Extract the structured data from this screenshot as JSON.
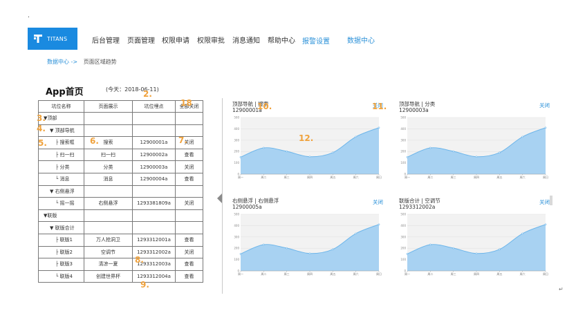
{
  "header": {
    "logo_text": "TITANS",
    "nav": [
      "后台管理",
      "页面管理",
      "权限申请",
      "权限审批",
      "消息通知",
      "帮助中心",
      "报警设置",
      "数据中心"
    ]
  },
  "breadcrumb": {
    "link": "数据中心 ->",
    "current": "页面区域趋势"
  },
  "page": {
    "title": "App首页",
    "date": "(今天：2018-06-11)"
  },
  "table": {
    "headers": [
      "坑位名称",
      "页面展示",
      "坑位埋点",
      "全部关闭"
    ],
    "rows": [
      {
        "name": "▼顶部",
        "display": "",
        "code": "",
        "action": ""
      },
      {
        "name": "▼ 顶部导航",
        "display": "",
        "code": "",
        "action": ""
      },
      {
        "name": "├ 搜索框",
        "display": "搜索",
        "code": "12900001a",
        "action": "关闭"
      },
      {
        "name": "├ 扫一扫",
        "display": "扫一扫",
        "code": "12900002a",
        "action": "查看"
      },
      {
        "name": "├ 分类",
        "display": "分类",
        "code": "12900003a",
        "action": "关闭"
      },
      {
        "name": "└ 消息",
        "display": "消息",
        "code": "12900004a",
        "action": "查看"
      },
      {
        "name": "▼ 右侧悬浮",
        "display": "",
        "code": "",
        "action": ""
      },
      {
        "name": "└ 摇一摇",
        "display": "右侧悬浮",
        "code": "1293381809a",
        "action": "关闭"
      },
      {
        "name": "▼联版",
        "display": "",
        "code": "",
        "action": ""
      },
      {
        "name": "▼ 联版合计",
        "display": "",
        "code": "",
        "action": ""
      },
      {
        "name": "├ 联版1",
        "display": "万人抢洞卫",
        "code": "1293312001a",
        "action": "查看"
      },
      {
        "name": "├ 联版2",
        "display": "空调节",
        "code": "1293312002a",
        "action": "关闭"
      },
      {
        "name": "├ 联版3",
        "display": "清凉一夏",
        "code": "1293312003a",
        "action": "查看"
      },
      {
        "name": "└ 联版4",
        "display": "创建世界杯",
        "code": "1293312004a",
        "action": "查看"
      }
    ]
  },
  "annotations": [
    "2.",
    "3.",
    "4.",
    "5.",
    "6.",
    "7.",
    "8.",
    "9.",
    "10.",
    "11.",
    "12.",
    "18"
  ],
  "panels": [
    {
      "title": "顶部导航 | 搜索",
      "code": "12900001a",
      "close": "关闭"
    },
    {
      "title": "顶部导航 | 分类",
      "code": "12900003a",
      "close": "关闭"
    },
    {
      "title": "右侧悬浮 | 右侧悬浮",
      "code": "12900005a",
      "close": "关闭"
    },
    {
      "title": "联版合计 | 空调节",
      "code": "1293312002a",
      "close": "关闭"
    }
  ],
  "chart_data": {
    "type": "area",
    "x": [
      "周一",
      "周二",
      "周三",
      "周四",
      "周五",
      "周六",
      "周日"
    ],
    "series": [
      {
        "values": [
          150,
          232,
          201,
          154,
          190,
          330,
          410
        ]
      }
    ],
    "ylim": [
      0,
      500
    ],
    "yticks": [
      0,
      100,
      200,
      300,
      400,
      500
    ],
    "colors": {
      "fill": "#a8d2f2",
      "line": "#6cb5ea"
    }
  },
  "mark": "↵"
}
